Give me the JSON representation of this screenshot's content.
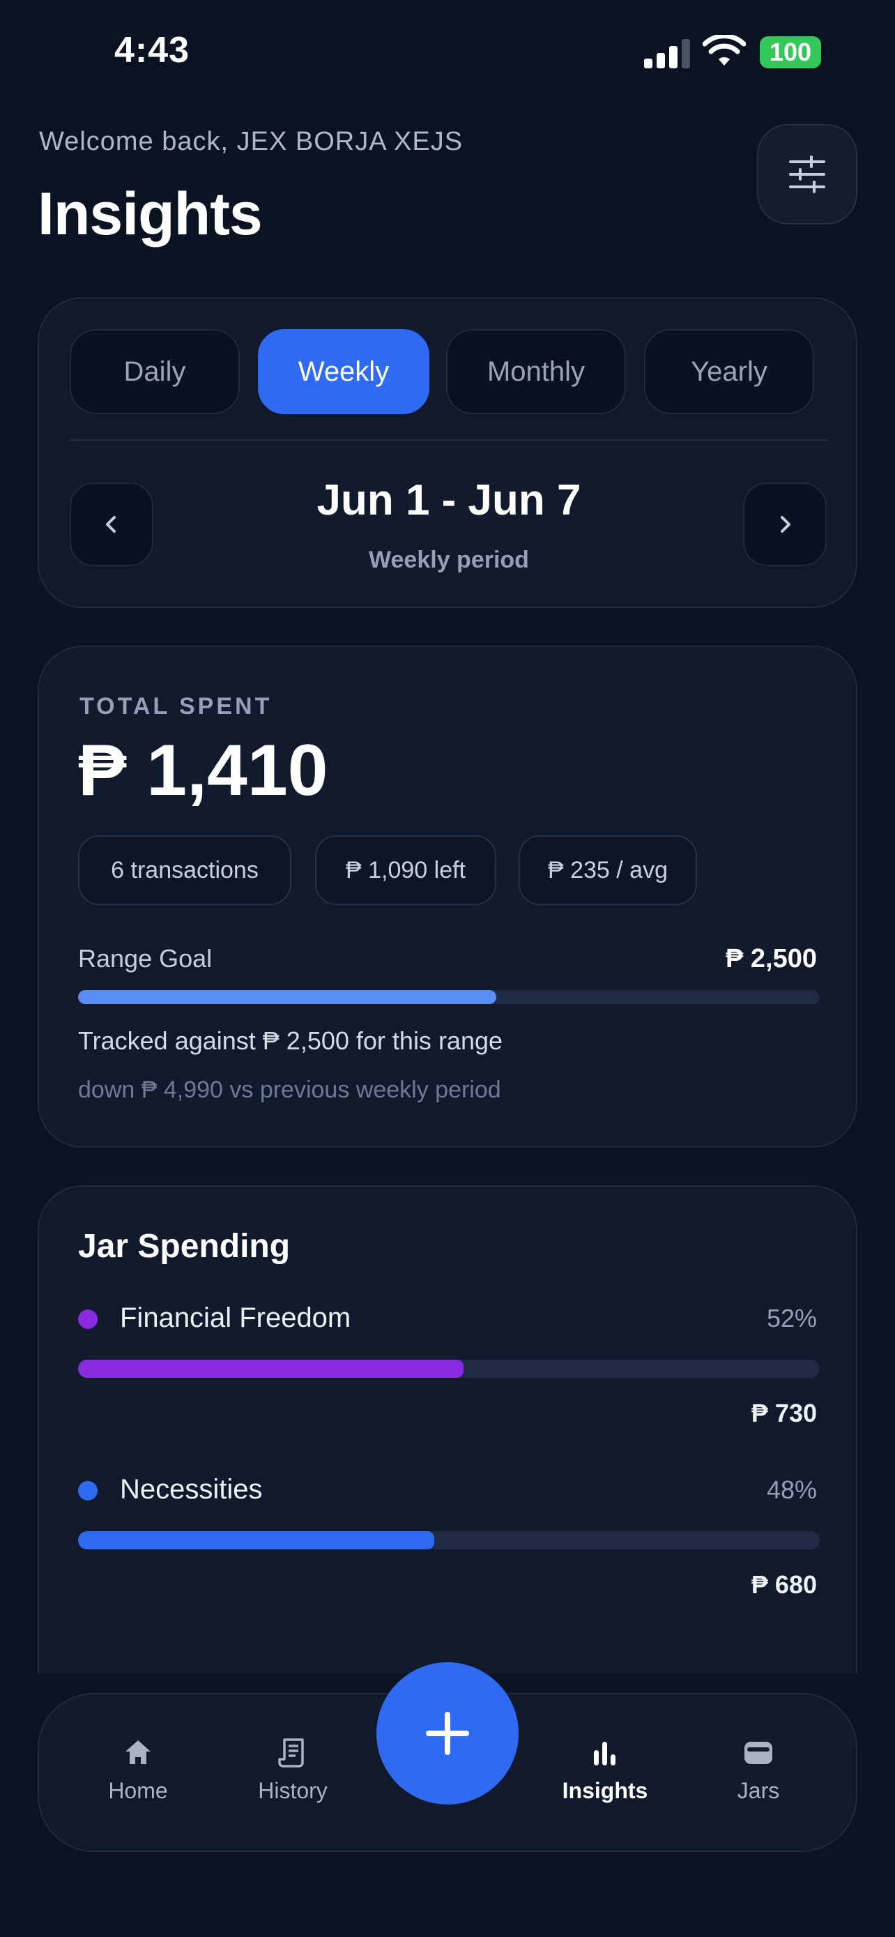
{
  "status_bar": {
    "time": "4:43",
    "battery": "100"
  },
  "header": {
    "welcome": "Welcome back, JEX BORJA XEJS",
    "title": "Insights"
  },
  "period": {
    "tabs": [
      {
        "label": "Daily",
        "active": false
      },
      {
        "label": "Weekly",
        "active": true
      },
      {
        "label": "Monthly",
        "active": false
      },
      {
        "label": "Yearly",
        "active": false
      }
    ],
    "range": "Jun 1 - Jun 7",
    "subtitle": "Weekly period"
  },
  "summary": {
    "label": "TOTAL SPENT",
    "amount": "₱ 1,410",
    "pills": [
      "6 transactions",
      "₱ 1,090 left",
      "₱ 235 / avg"
    ],
    "goal_label": "Range Goal",
    "goal_value": "₱ 2,500",
    "goal_progress": 0.564,
    "tracked_text": "Tracked against ₱ 2,500 for this range",
    "compare_text": "down ₱ 4,990 vs previous weekly period"
  },
  "jars": {
    "title": "Jar Spending",
    "items": [
      {
        "name": "Financial Freedom",
        "percent": "52%",
        "amount": "₱ 730",
        "progress": 0.52,
        "color": "#8a2be2"
      },
      {
        "name": "Necessities",
        "percent": "48%",
        "amount": "₱ 680",
        "progress": 0.48,
        "color": "#2f6bf2"
      }
    ]
  },
  "tabbar": {
    "items": [
      {
        "label": "Home",
        "icon": "home-icon",
        "active": false
      },
      {
        "label": "History",
        "icon": "receipt-icon",
        "active": false
      },
      {
        "label": "Insights",
        "icon": "bar-chart-icon",
        "active": true
      },
      {
        "label": "Jars",
        "icon": "jar-icon",
        "active": false
      }
    ],
    "fab_icon": "plus-icon"
  },
  "colors": {
    "background": "#0b1322",
    "card": "#111a2c",
    "accent": "#2f6bf2",
    "goal_fill": "#5b8ef5",
    "battery": "#34c759"
  }
}
